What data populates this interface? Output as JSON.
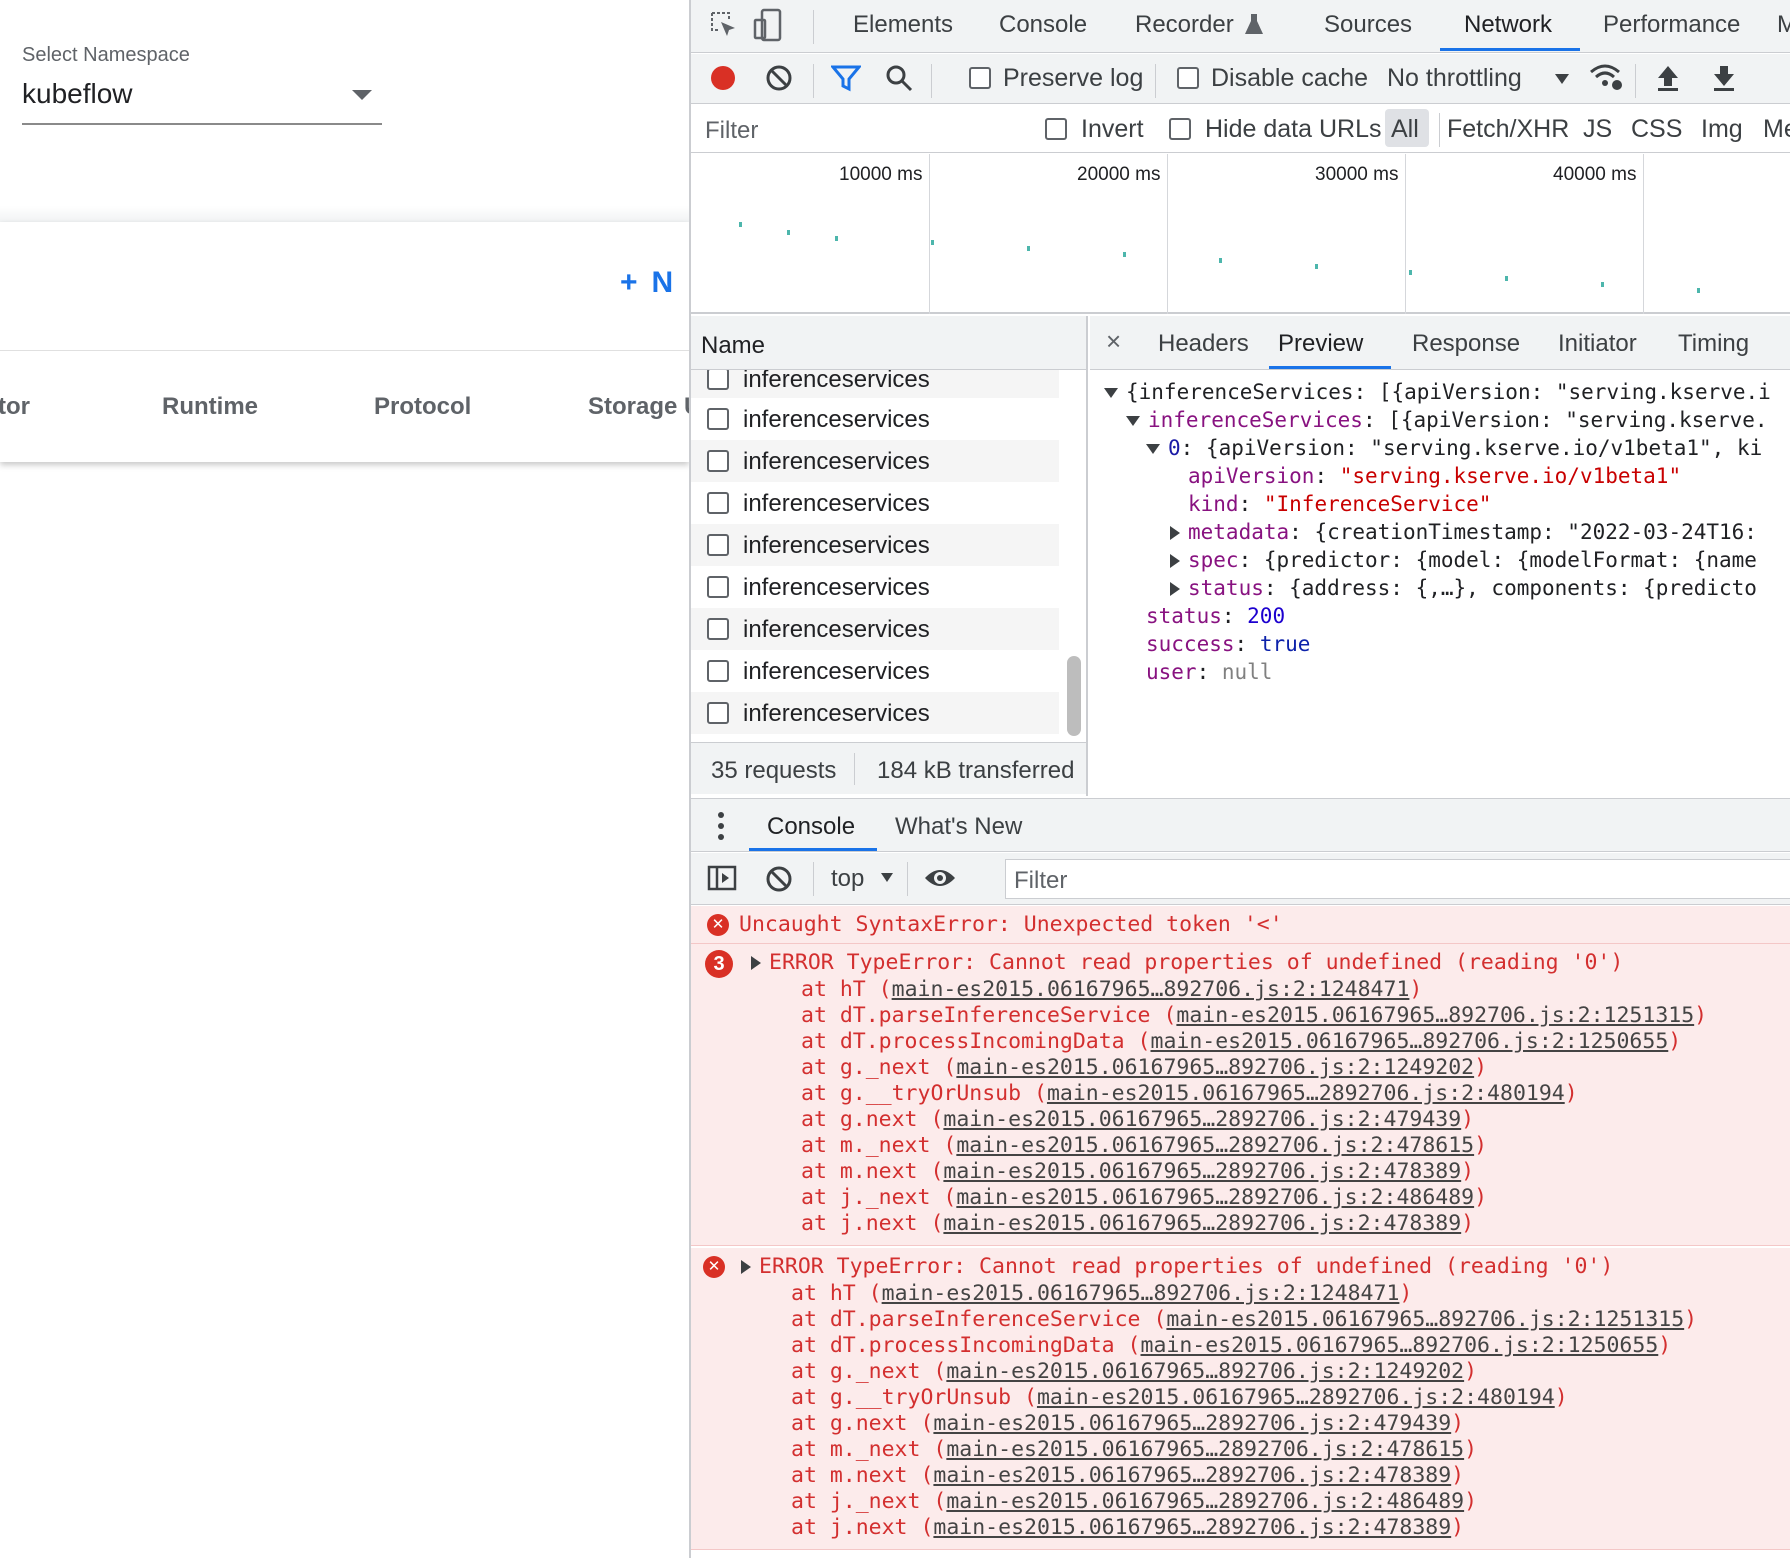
{
  "app": {
    "namespace_label": "Select Namespace",
    "namespace_value": "kubeflow",
    "new_button_label": "N",
    "columns": [
      "tor",
      "Runtime",
      "Protocol",
      "Storage U"
    ]
  },
  "devtools": {
    "tabs": [
      "Elements",
      "Console",
      "Recorder",
      "Sources",
      "Network",
      "Performance",
      "M"
    ],
    "active_tab": "Network",
    "toolbar": {
      "preserve_log": "Preserve log",
      "disable_cache": "Disable cache",
      "throttling": "No throttling"
    },
    "filterbar": {
      "placeholder": "Filter",
      "invert": "Invert",
      "hide_data_urls": "Hide data URLs",
      "types": [
        "All",
        "Fetch/XHR",
        "JS",
        "CSS",
        "Img",
        "Me"
      ]
    },
    "timeline": {
      "labels": [
        "10000 ms",
        "20000 ms",
        "30000 ms",
        "40000 ms"
      ]
    },
    "requests": {
      "column": "Name",
      "items": [
        "inferenceservices",
        "inferenceservices",
        "inferenceservices",
        "inferenceservices",
        "inferenceservices",
        "inferenceservices",
        "inferenceservices",
        "inferenceservices",
        "inferenceservices"
      ],
      "count": "35 requests",
      "transferred": "184 kB transferred"
    },
    "detail": {
      "tabs": [
        "Headers",
        "Preview",
        "Response",
        "Initiator",
        "Timing"
      ],
      "active_tab": "Preview",
      "close": "×",
      "json": {
        "l1_key": "{inferenceServices",
        "l1_val": ": [{apiVersion: \"serving.kserve.i",
        "l2_key": "inferenceServices",
        "l2_val": ": [{apiVersion: \"serving.kserve.",
        "l3_key": "0",
        "l3_val": ": {apiVersion: \"serving.kserve.io/v1beta1\", ki",
        "l4_key": "apiVersion",
        "l4_val": "\"serving.kserve.io/v1beta1\"",
        "l5_key": "kind",
        "l5_val": "\"InferenceService\"",
        "l6_key": "metadata",
        "l6_val": ": {creationTimestamp: \"2022-03-24T16:",
        "l7_key": "spec",
        "l7_val": ": {predictor: {model: {modelFormat: {name",
        "l8_key": "status",
        "l8_val": ": {address: {,…}, components: {predicto",
        "l9_key": "status",
        "l9_val": "200",
        "l10_key": "success",
        "l10_val": "true",
        "l11_key": "user",
        "l11_val": "null"
      }
    },
    "drawer": {
      "tabs": [
        "Console",
        "What's New"
      ],
      "context": "top",
      "filter_placeholder": "Filter"
    },
    "console": {
      "syntax_error": "Uncaught SyntaxError: Unexpected token '<'",
      "error_count": "3",
      "error_message": "ERROR TypeError: Cannot read properties of undefined (reading '0')",
      "stack": [
        {
          "fn": "at hT ",
          "loc": "main-es2015.06167965…892706.js:2:1248471"
        },
        {
          "fn": "at dT.parseInferenceService ",
          "loc": "main-es2015.06167965…892706.js:2:1251315"
        },
        {
          "fn": "at dT.processIncomingData ",
          "loc": "main-es2015.06167965…892706.js:2:1250655"
        },
        {
          "fn": "at g._next ",
          "loc": "main-es2015.06167965…892706.js:2:1249202"
        },
        {
          "fn": "at g.__tryOrUnsub ",
          "loc": "main-es2015.06167965…2892706.js:2:480194"
        },
        {
          "fn": "at g.next ",
          "loc": "main-es2015.06167965…2892706.js:2:479439"
        },
        {
          "fn": "at m._next ",
          "loc": "main-es2015.06167965…2892706.js:2:478615"
        },
        {
          "fn": "at m.next ",
          "loc": "main-es2015.06167965…2892706.js:2:478389"
        },
        {
          "fn": "at j._next ",
          "loc": "main-es2015.06167965…2892706.js:2:486489"
        },
        {
          "fn": "at j.next ",
          "loc": "main-es2015.06167965…2892706.js:2:478389"
        }
      ]
    }
  }
}
